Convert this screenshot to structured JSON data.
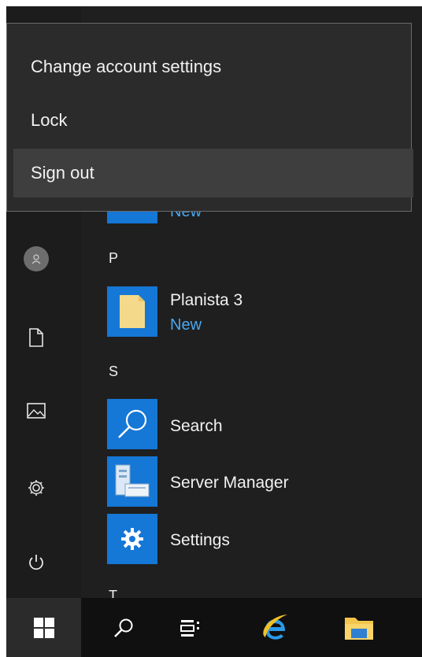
{
  "account_menu": {
    "items": [
      {
        "label": "Change account settings"
      },
      {
        "label": "Lock"
      },
      {
        "label": "Sign out",
        "highlighted": true
      }
    ]
  },
  "app_list": {
    "partial_tile_label": "New",
    "groups": [
      {
        "letter": "P",
        "apps": [
          {
            "name": "Planista 3",
            "badge": "New",
            "icon": "folder-icon"
          }
        ]
      },
      {
        "letter": "S",
        "apps": [
          {
            "name": "Search",
            "icon": "search-icon"
          },
          {
            "name": "Server Manager",
            "icon": "server-manager-icon"
          },
          {
            "name": "Settings",
            "icon": "gear-icon"
          }
        ]
      },
      {
        "letter": "T",
        "apps": []
      }
    ]
  },
  "left_rail": {
    "icons": [
      "user-avatar-icon",
      "documents-icon",
      "pictures-icon",
      "settings-icon",
      "power-icon"
    ]
  },
  "taskbar": {
    "icons": [
      "windows-start-icon",
      "search-icon",
      "task-view-icon",
      "internet-explorer-icon",
      "file-explorer-icon"
    ]
  },
  "colors": {
    "tile_blue": "#1577d6",
    "accent_text": "#4aa8ef",
    "menu_background": "#2b2b2b",
    "menu_highlight": "#3e3e3e"
  }
}
